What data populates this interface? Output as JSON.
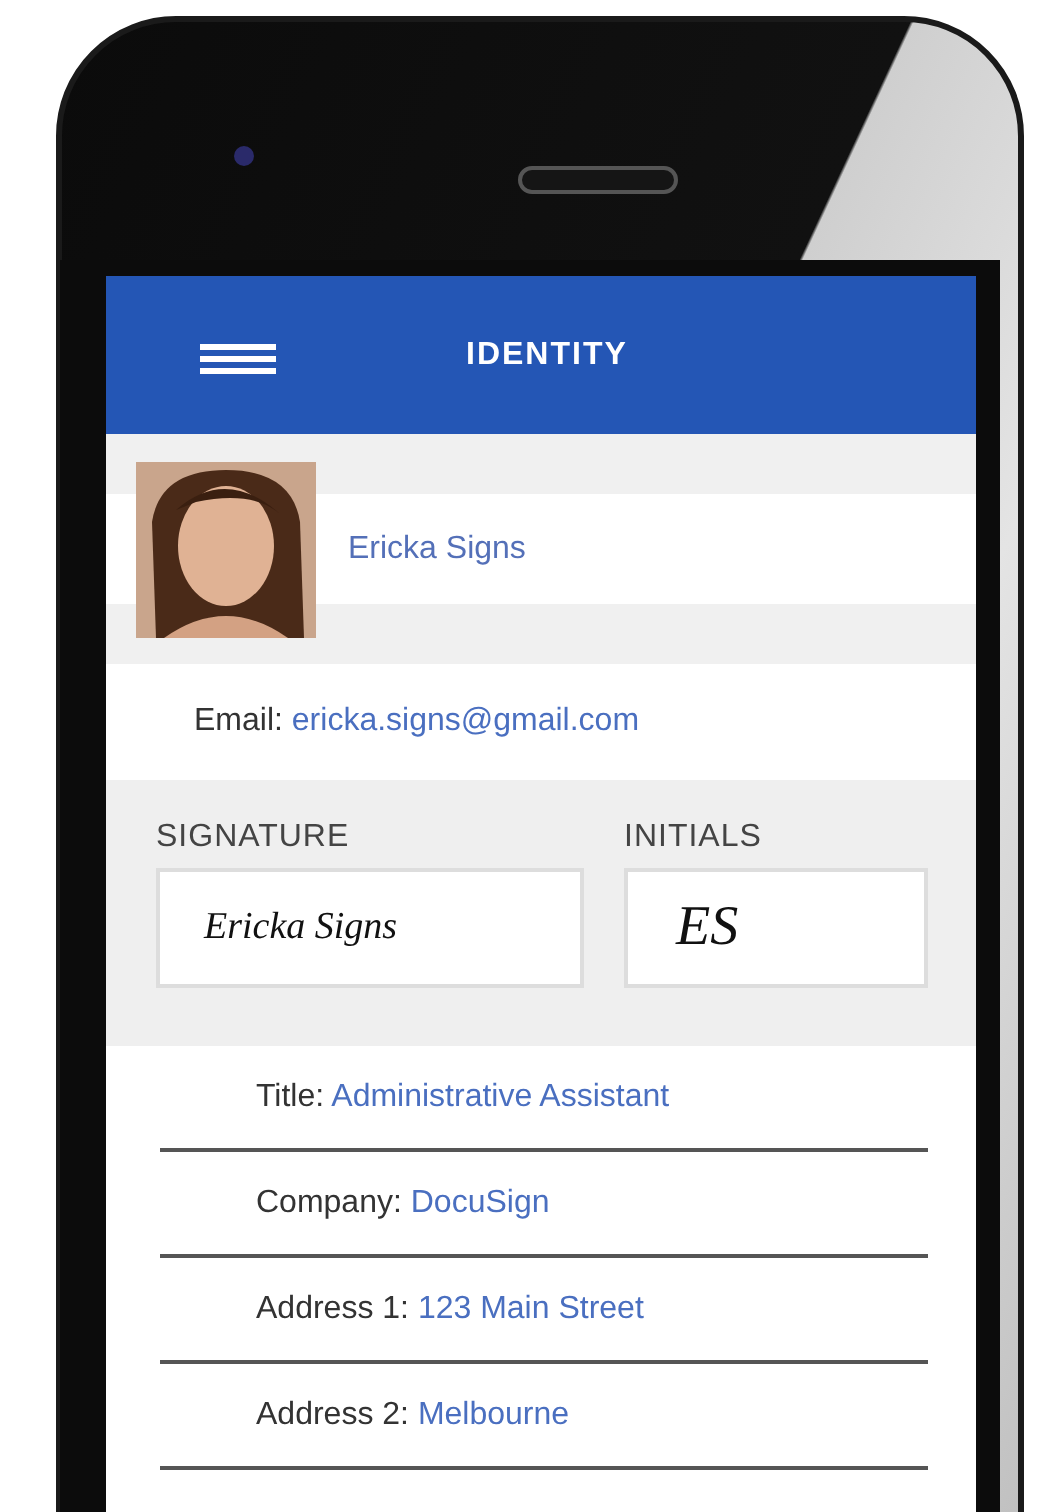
{
  "header": {
    "title": "IDENTITY"
  },
  "profile": {
    "name": "Ericka Signs"
  },
  "email": {
    "label": "Email:",
    "value": "ericka.signs@gmail.com"
  },
  "signature": {
    "label": "SIGNATURE",
    "value": "Ericka Signs"
  },
  "initials": {
    "label": "INITIALS",
    "value": "ES"
  },
  "fields": [
    {
      "label": "Title:",
      "value": "Administrative Assistant"
    },
    {
      "label": "Company:",
      "value": "DocuSign"
    },
    {
      "label": "Address 1:",
      "value": "123 Main Street"
    },
    {
      "label": "Address 2:",
      "value": "Melbourne"
    }
  ]
}
